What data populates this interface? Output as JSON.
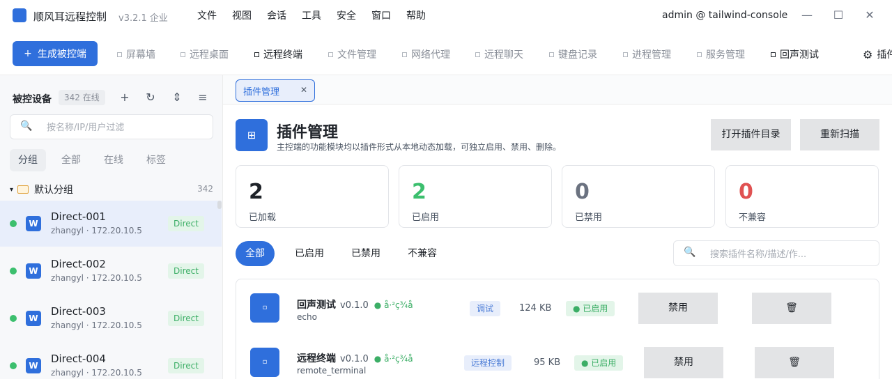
{
  "app": {
    "name": "顺风耳远程控制",
    "version": "v3.2.1 企业",
    "user": "admin @ tailwind-console",
    "accent": "#2f6fdc"
  },
  "menu": [
    "文件",
    "视图",
    "会话",
    "工具",
    "安全",
    "窗口",
    "帮助"
  ],
  "window_controls": {
    "minimize": "—",
    "maximize": "☐",
    "close": "✕"
  },
  "toolbar": {
    "generate_label": "生成被控端",
    "generate_icon": "+",
    "tabs": [
      {
        "label": "屏幕墙"
      },
      {
        "label": "远程桌面"
      },
      {
        "label": "远程终端"
      },
      {
        "label": "文件管理"
      },
      {
        "label": "网络代理"
      },
      {
        "label": "远程聊天"
      },
      {
        "label": "键盘记录"
      },
      {
        "label": "进程管理"
      },
      {
        "label": "服务管理"
      },
      {
        "label": "回声测试"
      },
      {
        "label": "插件"
      }
    ]
  },
  "sidebar": {
    "title": "被控设备",
    "count": "342 在线",
    "icons": {
      "add": "+",
      "refresh": "↻",
      "sort": "⇕",
      "menu": "≡"
    },
    "search": {
      "placeholder": "按名称/IP/用户过滤",
      "icon": "🔍"
    },
    "filter_tabs": [
      "分组",
      "全部",
      "在线",
      "标签"
    ],
    "group": {
      "name": "默认分组",
      "count": "342",
      "caret": "▾"
    },
    "devices": [
      {
        "name": "Direct-001",
        "sub": "zhangyl · 172.20.10.5",
        "badge": "Direct",
        "os": "W"
      },
      {
        "name": "Direct-002",
        "sub": "zhangyl · 172.20.10.5",
        "badge": "Direct",
        "os": "W"
      },
      {
        "name": "Direct-003",
        "sub": "zhangyl · 172.20.10.5",
        "badge": "Direct",
        "os": "W"
      },
      {
        "name": "Direct-004",
        "sub": "zhangyl · 172.20.10.5",
        "badge": "Direct",
        "os": "W"
      }
    ]
  },
  "doc_tab": {
    "label": "插件管理",
    "close": "✕"
  },
  "main": {
    "header_icon": "⊞",
    "title": "插件管理",
    "description": "主控端的功能模块均以插件形式从本地动态加载，可独立启用、禁用、删除。",
    "open_dir": "打开插件目录",
    "rescan": "重新扫描",
    "stats": [
      {
        "value": "2",
        "label": "已加载",
        "color": "#1f2329"
      },
      {
        "value": "2",
        "label": "已启用",
        "color": "#3cbf6e"
      },
      {
        "value": "0",
        "label": "已禁用",
        "color": "#6b7280"
      },
      {
        "value": "0",
        "label": "不兼容",
        "color": "#e05252"
      }
    ],
    "filters": [
      "全部",
      "已启用",
      "已禁用",
      "不兼容"
    ],
    "search": {
      "placeholder": "搜索插件名称/描述/作...",
      "icon": "🔍"
    },
    "plugins": [
      {
        "name": "回声测试",
        "version": "v0.1.0",
        "status_inline": "● å·²ç¾å",
        "id": "echo",
        "category": "调试",
        "size": "124 KB",
        "status": "● 已启用",
        "action": "禁用",
        "delete_icon": "🗑"
      },
      {
        "name": "远程终端",
        "version": "v0.1.0",
        "status_inline": "● å·²ç¾å",
        "id": "remote_terminal",
        "category": "远程控制",
        "size": "95 KB",
        "status": "● 已启用",
        "action": "禁用",
        "delete_icon": "🗑"
      }
    ],
    "plugin_icon": "▫"
  }
}
